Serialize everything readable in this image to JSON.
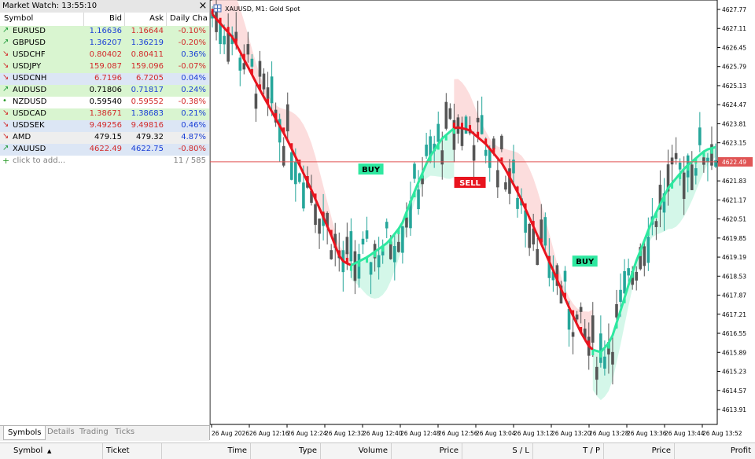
{
  "market_watch": {
    "title": "Market Watch: 13:55:10",
    "close": "×",
    "columns": [
      "Symbol",
      "Bid",
      "Ask",
      "Daily Cha..."
    ],
    "rows": [
      {
        "symbol": "EURUSD",
        "dir": "up",
        "bid": "1.16636",
        "ask": "1.16644",
        "change": "-0.10%",
        "bg": "#d9f5d0",
        "bid_color": "#1a3fd6",
        "ask_color": "#d22a2a",
        "change_color": "#d22a2a"
      },
      {
        "symbol": "GBPUSD",
        "dir": "up",
        "bid": "1.36207",
        "ask": "1.36219",
        "change": "-0.20%",
        "bg": "#d9f5d0",
        "bid_color": "#1a3fd6",
        "ask_color": "#1a3fd6",
        "change_color": "#d22a2a"
      },
      {
        "symbol": "USDCHF",
        "dir": "down",
        "bid": "0.80402",
        "ask": "0.80411",
        "change": "0.36%",
        "bg": "#d9f5d0",
        "bid_color": "#d22a2a",
        "ask_color": "#d22a2a",
        "change_color": "#1a3fd6"
      },
      {
        "symbol": "USDJPY",
        "dir": "down",
        "bid": "159.087",
        "ask": "159.096",
        "change": "-0.07%",
        "bg": "#d9f5d0",
        "bid_color": "#d22a2a",
        "ask_color": "#d22a2a",
        "change_color": "#d22a2a"
      },
      {
        "symbol": "USDCNH",
        "dir": "down",
        "bid": "6.7196",
        "ask": "6.7205",
        "change": "0.04%",
        "bg": "#dce6f5",
        "bid_color": "#d22a2a",
        "ask_color": "#d22a2a",
        "change_color": "#1a3fd6"
      },
      {
        "symbol": "AUDUSD",
        "dir": "up",
        "bid": "0.71806",
        "ask": "0.71817",
        "change": "0.24%",
        "bg": "#d9f5d0",
        "bid_color": "#000000",
        "ask_color": "#1a3fd6",
        "change_color": "#1a3fd6"
      },
      {
        "symbol": "NZDUSD",
        "dir": "dot",
        "bid": "0.59540",
        "ask": "0.59552",
        "change": "-0.38%",
        "bg": "#ffffff",
        "bid_color": "#000000",
        "ask_color": "#d22a2a",
        "change_color": "#d22a2a"
      },
      {
        "symbol": "USDCAD",
        "dir": "down",
        "bid": "1.38671",
        "ask": "1.38683",
        "change": "0.21%",
        "bg": "#d9f5d0",
        "bid_color": "#d22a2a",
        "ask_color": "#1a3fd6",
        "change_color": "#1a3fd6"
      },
      {
        "symbol": "USDSEK",
        "dir": "down",
        "bid": "9.49256",
        "ask": "9.49816",
        "change": "0.46%",
        "bg": "#dce6f5",
        "bid_color": "#d22a2a",
        "ask_color": "#d22a2a",
        "change_color": "#1a3fd6"
      },
      {
        "symbol": "AMD",
        "dir": "down",
        "bid": "479.15",
        "ask": "479.32",
        "change": "4.87%",
        "bg": "#eeeeee",
        "bid_color": "#000000",
        "ask_color": "#000000",
        "change_color": "#1a3fd6"
      },
      {
        "symbol": "XAUUSD",
        "dir": "up",
        "bid": "4622.49",
        "ask": "4622.75",
        "change": "-0.80%",
        "bg": "#dce6f5",
        "bid_color": "#d22a2a",
        "ask_color": "#1a3fd6",
        "change_color": "#d22a2a"
      }
    ],
    "add_label": "click to add...",
    "count": "11 / 585",
    "tabs": [
      "Symbols",
      "Details",
      "Trading",
      "Ticks"
    ]
  },
  "chart": {
    "title": "XAUUSD, M1:  Gold Spot",
    "price_labels": [
      "4627.77",
      "4627.11",
      "4626.45",
      "4625.79",
      "4625.13",
      "4624.47",
      "4623.81",
      "4623.15",
      "4622.49",
      "4621.83",
      "4621.17",
      "4620.51",
      "4619.85",
      "4619.19",
      "4618.53",
      "4617.87",
      "4617.21",
      "4616.55",
      "4615.89",
      "4615.23",
      "4614.57",
      "4613.91"
    ],
    "current_price": "4622.49",
    "time_labels": [
      "26 Aug 2026",
      "26 Aug 12:16",
      "26 Aug 12:24",
      "26 Aug 12:32",
      "26 Aug 12:40",
      "26 Aug 12:48",
      "26 Aug 12:56",
      "26 Aug 13:04",
      "26 Aug 13:12",
      "26 Aug 13:20",
      "26 Aug 13:28",
      "26 Aug 13:36",
      "26 Aug 13:44",
      "26 Aug 13:52"
    ],
    "signals": [
      {
        "label": "BUY",
        "color": "#2ee8a0"
      },
      {
        "label": "SELL",
        "color": "#e8141e"
      },
      {
        "label": "BUY",
        "color": "#2ee8a0"
      }
    ],
    "colors": {
      "bull": "#26a69a",
      "bear": "#555555",
      "down_line": "#e8141e",
      "up_line": "#2ee8a0",
      "price_line": "#e05555"
    }
  },
  "toolbox": {
    "columns": [
      "Symbol",
      "Ticket",
      "Time",
      "Type",
      "Volume",
      "Price",
      "S / L",
      "T / P",
      "Price",
      "Profit"
    ]
  }
}
